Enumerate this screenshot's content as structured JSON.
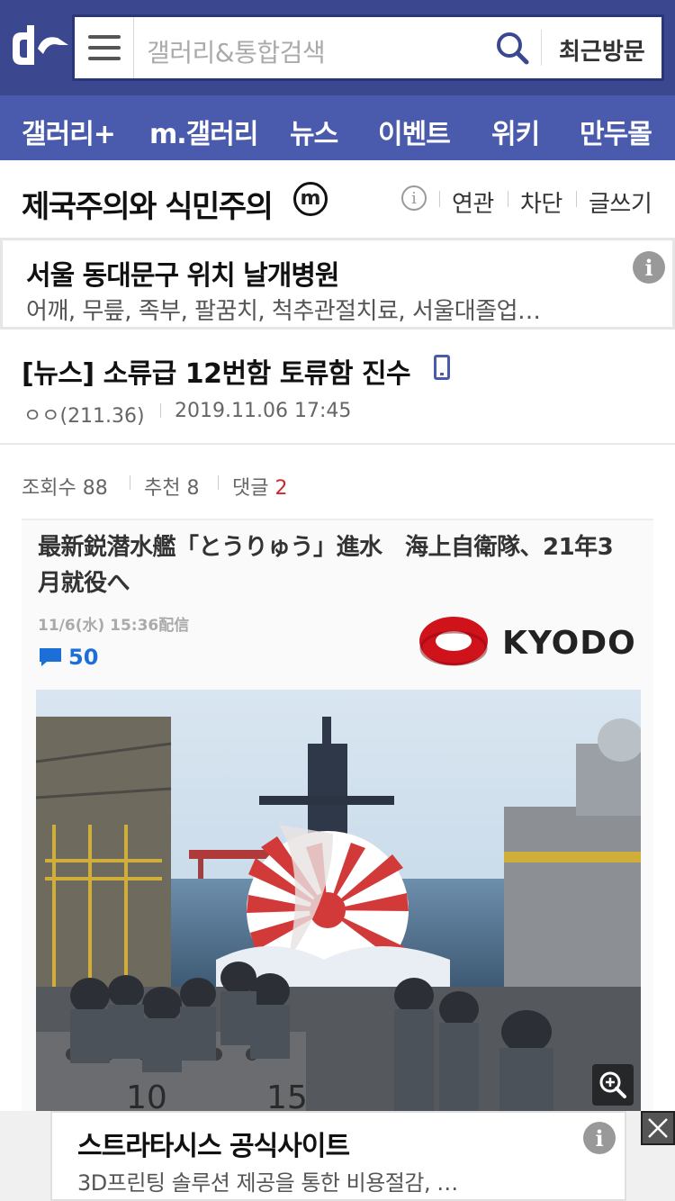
{
  "header": {
    "logo_icon": "dc-logo",
    "menu_icon": "hamburger-icon",
    "search_placeholder": "갤러리&통합검색",
    "search_icon": "search-icon",
    "recent_label": "최근방문"
  },
  "nav": {
    "items": [
      "갤러리+",
      "m.갤러리",
      "뉴스",
      "이벤트",
      "위키",
      "만두몰"
    ]
  },
  "gallery": {
    "title": "제국주의와 식민주의",
    "badge": "m",
    "info_icon": "info-icon",
    "actions": [
      "연관",
      "차단",
      "글쓰기"
    ]
  },
  "ad_top": {
    "title": "서울 동대문구 위치 날개병원",
    "description": "어깨, 무릎, 족부, 팔꿈치, 척추관절치료, 서울대졸업…",
    "info_icon": "info-icon"
  },
  "post": {
    "title": "[뉴스] 소류급 12번함 토류함 진수",
    "device_icon": "mobile-icon",
    "author": "ㅇㅇ(211.36)",
    "datetime": "2019.11.06 17:45",
    "views_label": "조회수",
    "views": "88",
    "recommend_label": "추천",
    "recommend": "8",
    "comments_label": "댓글",
    "comments": "2"
  },
  "news_card": {
    "headline": "最新鋭潜水艦「とうりゅう」進水　海上自衛隊、21年3月就役へ",
    "date": "11/6(水) 15:36配信",
    "comment_count": "50",
    "comment_icon": "comment-bubble-icon",
    "source": "KYODO",
    "photo_hull_numbers": [
      "10",
      "15"
    ],
    "zoom_icon": "zoom-in-icon"
  },
  "ad_bottom": {
    "title": "스트라타시스 공식사이트",
    "description": "3D프린팅 솔루션 제공을 통한 비용절감, …",
    "info_icon": "info-icon",
    "close_icon": "close-icon"
  },
  "colors": {
    "header_bg": "#3b4890",
    "nav_bg": "#4a5aac",
    "comment_red": "#d0262c",
    "link_blue": "#1d6fd8",
    "kyodo_red": "#d0121b"
  }
}
